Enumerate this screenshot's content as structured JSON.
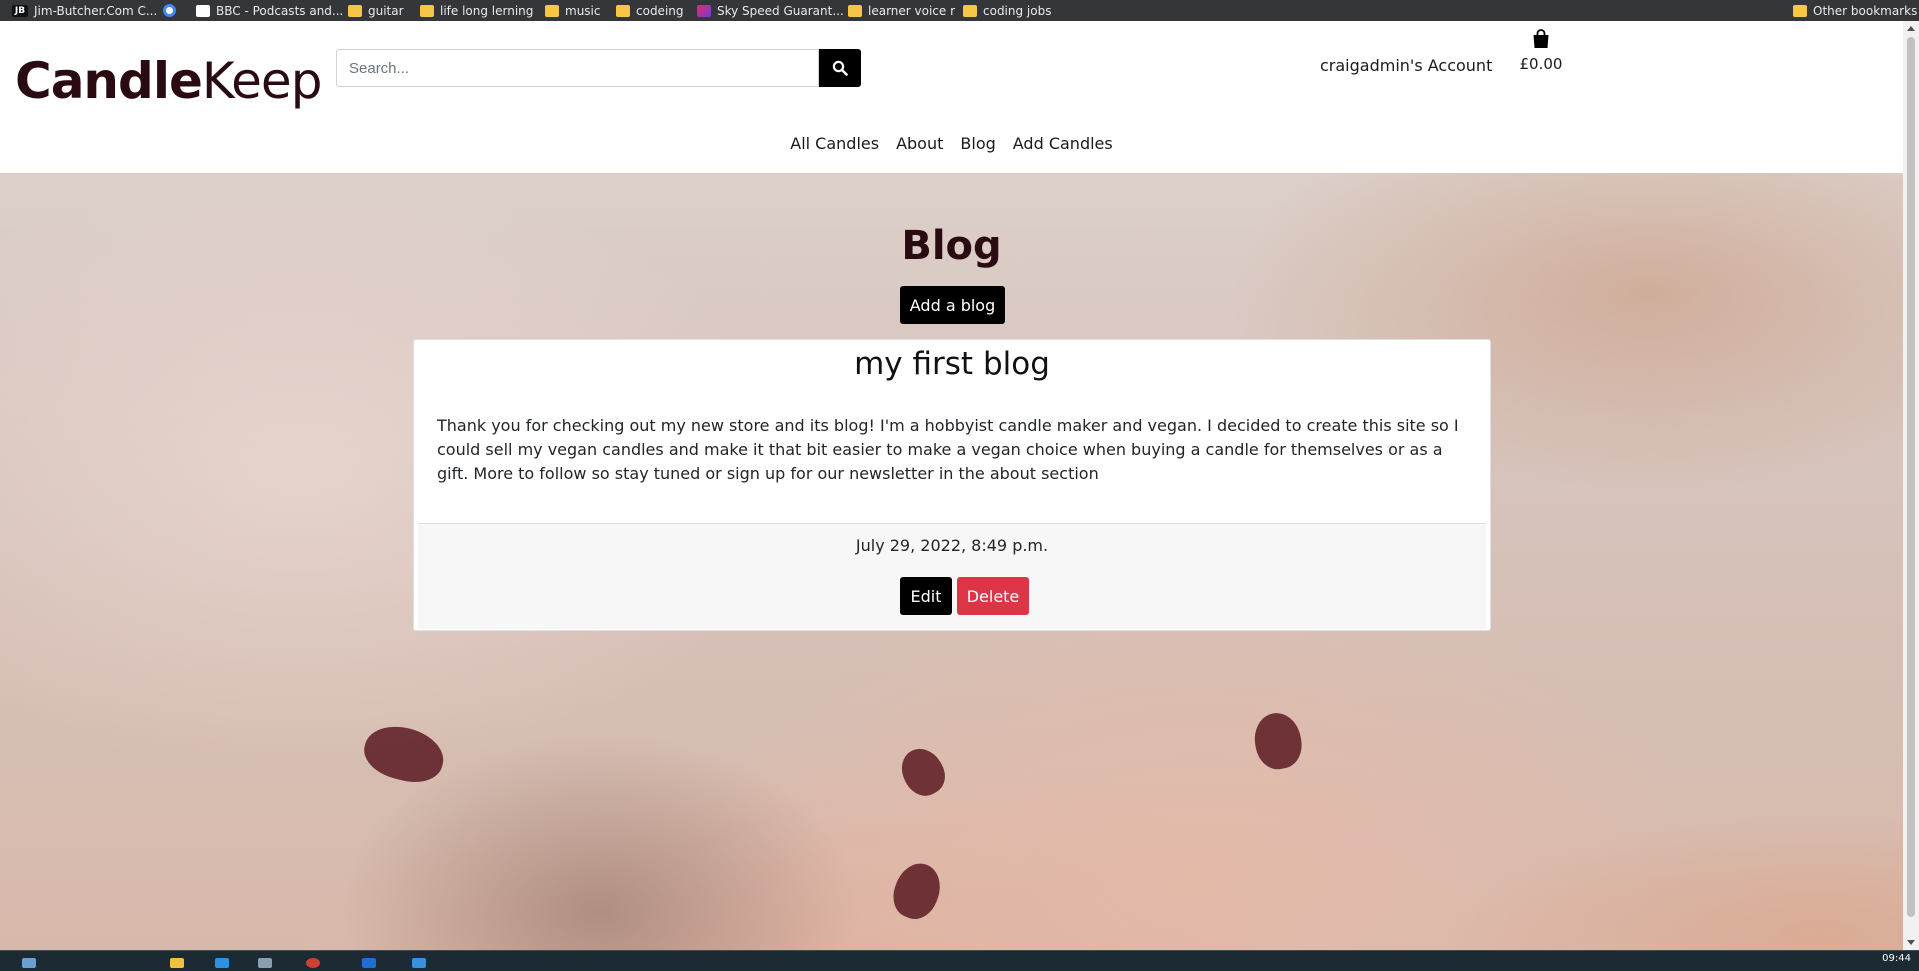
{
  "bookmarks": [
    {
      "label": "Jim-Butcher.Com C...",
      "icon": "jb-favicon"
    },
    {
      "label": "",
      "icon": "google-favicon"
    },
    {
      "label": "BBC - Podcasts and...",
      "icon": "bbc-favicon"
    },
    {
      "label": "guitar",
      "icon": "folder-icon"
    },
    {
      "label": "life long lerning",
      "icon": "folder-icon"
    },
    {
      "label": "music",
      "icon": "folder-icon"
    },
    {
      "label": "codeing",
      "icon": "folder-icon"
    },
    {
      "label": "Sky Speed Guarant...",
      "icon": "sky-favicon"
    },
    {
      "label": "learner voice r",
      "icon": "folder-icon"
    },
    {
      "label": "coding jobs",
      "icon": "folder-icon"
    }
  ],
  "other_bookmarks": "Other bookmarks",
  "header": {
    "logo_bold": "Candle",
    "logo_light": "Keep",
    "search_placeholder": "Search...",
    "account_label": "craigadmin's Account",
    "bag_total": "£0.00"
  },
  "nav": [
    "All Candles",
    "About",
    "Blog",
    "Add Candles"
  ],
  "page": {
    "title": "Blog",
    "add_button": "Add a blog"
  },
  "post": {
    "title": "my first blog",
    "body": "Thank you for checking out my new store and its blog! I'm a hobbyist candle maker and vegan. I decided to create this site so I could sell my vegan candles and make it that bit easier to make a vegan choice when buying a candle for themselves or as a gift. More to follow so stay tuned or sign up for our newsletter in the about section",
    "date": "July 29, 2022, 8:49 p.m.",
    "edit_label": "Edit",
    "delete_label": "Delete"
  },
  "taskbar": {
    "clock": "09:44"
  },
  "colors": {
    "brand": "#2a0b12",
    "delete": "#dc3545",
    "primary_button": "#000000"
  }
}
